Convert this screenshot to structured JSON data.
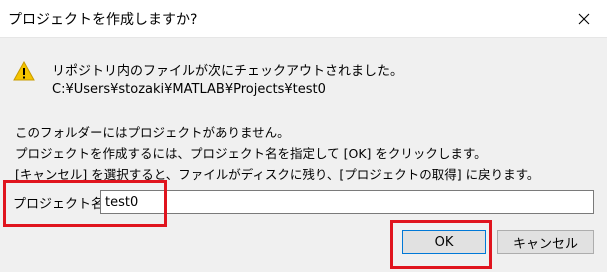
{
  "window": {
    "title": "プロジェクトを作成しますか?",
    "close_icon": "close-icon"
  },
  "message": {
    "icon": "warning-icon",
    "line1": "リポジトリ内のファイルが次にチェックアウトされました。",
    "line2": "C:¥Users¥stozaki¥MATLAB¥Projects¥test0"
  },
  "info": {
    "line1": "このフォルダーにはプロジェクトがありません。",
    "line2": "プロジェクトを作成するには、プロジェクト名を指定して [OK] をクリックします。",
    "line3": "[キャンセル] を選択すると、ファイルがディスクに残り、[プロジェクトの取得] に戻ります。"
  },
  "project_name": {
    "label": "プロジェクト名:",
    "value": "test0"
  },
  "buttons": {
    "ok": "OK",
    "cancel": "キャンセル"
  },
  "colors": {
    "highlight": "#e0141e",
    "warning": "#f5c400",
    "focus_border": "#0078d7"
  }
}
